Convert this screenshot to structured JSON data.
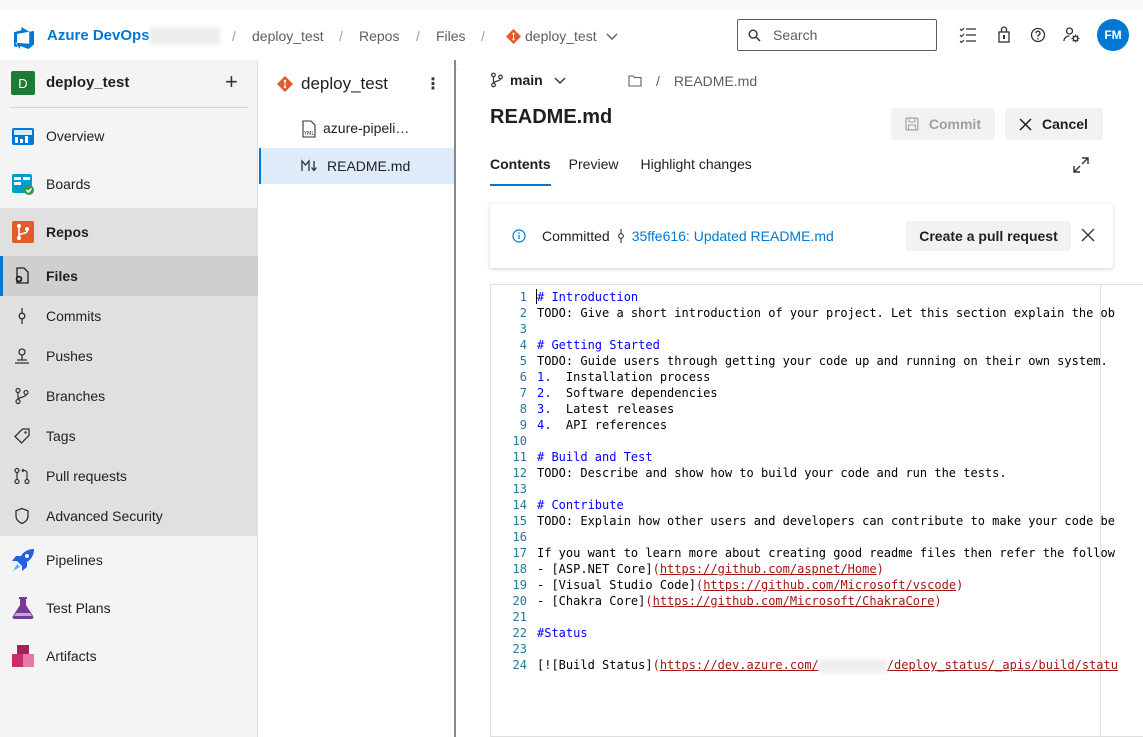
{
  "topbar": {
    "brand": "Azure DevOps",
    "crumbs": [
      "deploy_test",
      "Repos",
      "Files",
      "deploy_test"
    ],
    "search_placeholder": "Search",
    "avatar_initials": "FM"
  },
  "project": {
    "initial": "D",
    "name": "deploy_test"
  },
  "nav": {
    "overview": "Overview",
    "boards": "Boards",
    "repos": "Repos",
    "files": "Files",
    "commits": "Commits",
    "pushes": "Pushes",
    "branches": "Branches",
    "tags": "Tags",
    "pull_requests": "Pull requests",
    "advanced_security": "Advanced Security",
    "pipelines": "Pipelines",
    "test_plans": "Test Plans",
    "artifacts": "Artifacts"
  },
  "filepanel": {
    "repo": "deploy_test",
    "files": [
      {
        "name": "azure-pipeli…",
        "icon": "yml-file-icon"
      },
      {
        "name": "README.md",
        "icon": "markdown-file-icon"
      }
    ]
  },
  "main": {
    "branch": "main",
    "path_file": "README.md",
    "title": "README.md",
    "commit_label": "Commit",
    "cancel_label": "Cancel",
    "tabs": [
      "Contents",
      "Preview",
      "Highlight changes"
    ],
    "banner": {
      "prefix": "Committed",
      "commit_link": "35ffe616: Updated README.md",
      "pr_button": "Create a pull request"
    }
  },
  "editor": {
    "lines": [
      {
        "n": "1",
        "parts": [
          [
            "h",
            "# Introduction"
          ]
        ]
      },
      {
        "n": "2",
        "parts": [
          [
            "t",
            "TODO: Give a short introduction of your project. Let this section explain the ob"
          ]
        ]
      },
      {
        "n": "3",
        "parts": []
      },
      {
        "n": "4",
        "parts": [
          [
            "h",
            "# Getting Started"
          ]
        ]
      },
      {
        "n": "5",
        "parts": [
          [
            "t",
            "TODO: Guide users through getting your code up and running on their own system."
          ]
        ]
      },
      {
        "n": "6",
        "parts": [
          [
            "h",
            "1."
          ],
          [
            "t",
            "  Installation process"
          ]
        ]
      },
      {
        "n": "7",
        "parts": [
          [
            "h",
            "2."
          ],
          [
            "t",
            "  Software dependencies"
          ]
        ]
      },
      {
        "n": "8",
        "parts": [
          [
            "h",
            "3."
          ],
          [
            "t",
            "  Latest releases"
          ]
        ]
      },
      {
        "n": "9",
        "parts": [
          [
            "h",
            "4."
          ],
          [
            "t",
            "  API references"
          ]
        ]
      },
      {
        "n": "10",
        "parts": []
      },
      {
        "n": "11",
        "parts": [
          [
            "h",
            "# Build and Test"
          ]
        ]
      },
      {
        "n": "12",
        "parts": [
          [
            "t",
            "TODO: Describe and show how to build your code and run the tests."
          ]
        ]
      },
      {
        "n": "13",
        "parts": []
      },
      {
        "n": "14",
        "parts": [
          [
            "h",
            "# Contribute"
          ]
        ]
      },
      {
        "n": "15",
        "parts": [
          [
            "t",
            "TODO: Explain how other users and developers can contribute to make your code be"
          ]
        ]
      },
      {
        "n": "16",
        "parts": []
      },
      {
        "n": "17",
        "parts": [
          [
            "t",
            "If you want to learn more about creating good readme files then refer the follow"
          ]
        ]
      },
      {
        "n": "18",
        "parts": [
          [
            "t",
            "- [ASP.NET Core]"
          ],
          [
            "s",
            "("
          ],
          [
            "u",
            "https://github.com/aspnet/Home"
          ],
          [
            "s",
            ")"
          ]
        ]
      },
      {
        "n": "19",
        "parts": [
          [
            "t",
            "- [Visual Studio Code]"
          ],
          [
            "s",
            "("
          ],
          [
            "u",
            "https://github.com/Microsoft/vscode"
          ],
          [
            "s",
            ")"
          ]
        ]
      },
      {
        "n": "20",
        "parts": [
          [
            "t",
            "- [Chakra Core]"
          ],
          [
            "s",
            "("
          ],
          [
            "u",
            "https://github.com/Microsoft/ChakraCore"
          ],
          [
            "s",
            ")"
          ]
        ]
      },
      {
        "n": "21",
        "parts": []
      },
      {
        "n": "22",
        "parts": [
          [
            "h",
            "#Status"
          ]
        ]
      },
      {
        "n": "23",
        "parts": []
      },
      {
        "n": "24",
        "parts": [
          [
            "t",
            "[![Build Status]"
          ],
          [
            "s",
            "("
          ],
          [
            "u",
            "https://dev.azure.com/"
          ],
          [
            "b",
            ""
          ],
          [
            "u",
            "/deploy_status/_apis/build/statu"
          ]
        ]
      }
    ]
  },
  "colors": {
    "accent": "#0078d4",
    "heading": "#0000ff",
    "link": "#a31515"
  }
}
